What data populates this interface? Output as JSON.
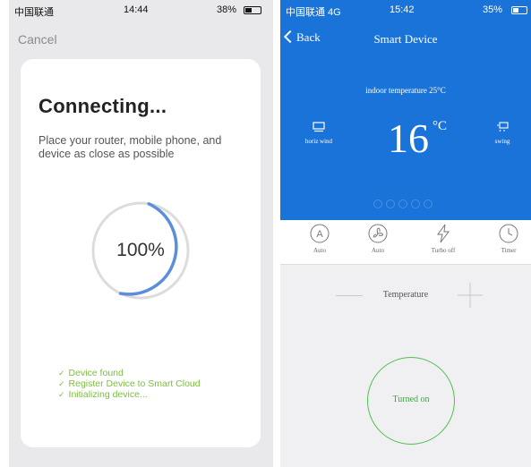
{
  "left": {
    "status": {
      "carrier": "中国联通",
      "time": "14:44",
      "battery": "38%"
    },
    "cancel": "Cancel",
    "title": "Connecting...",
    "description": "Place your router, mobile phone, and device as close as possible",
    "progress": {
      "label": "100%",
      "fraction": 1.0,
      "ring_color": "#5b8fdc"
    },
    "steps": [
      "Device found",
      "Register Device to Smart Cloud",
      "Initializing device..."
    ],
    "step_color": "#7bbf3c"
  },
  "right": {
    "status": {
      "carrier": "中国联通 4G",
      "time": "15:42",
      "battery": "35%"
    },
    "back": "Back",
    "title": "Smart Device",
    "indoor": "indoor temperature  25°C",
    "temperature": "16",
    "unit": "°C",
    "left_mode": {
      "label": "horiz wind",
      "icon": "horizontal-wind-icon"
    },
    "right_mode": {
      "label": "swing",
      "icon": "swing-icon"
    },
    "tools": [
      {
        "label": "Auto",
        "icon": "auto-mode-icon"
      },
      {
        "label": "Auto",
        "icon": "fan-icon"
      },
      {
        "label": "Turbo off",
        "icon": "lightning-icon"
      },
      {
        "label": "Timer",
        "icon": "clock-icon"
      }
    ],
    "temp_control_label": "Temperature",
    "power_label": "Turned on",
    "accent": "#1a73d9",
    "power_color": "#4fc04f"
  }
}
